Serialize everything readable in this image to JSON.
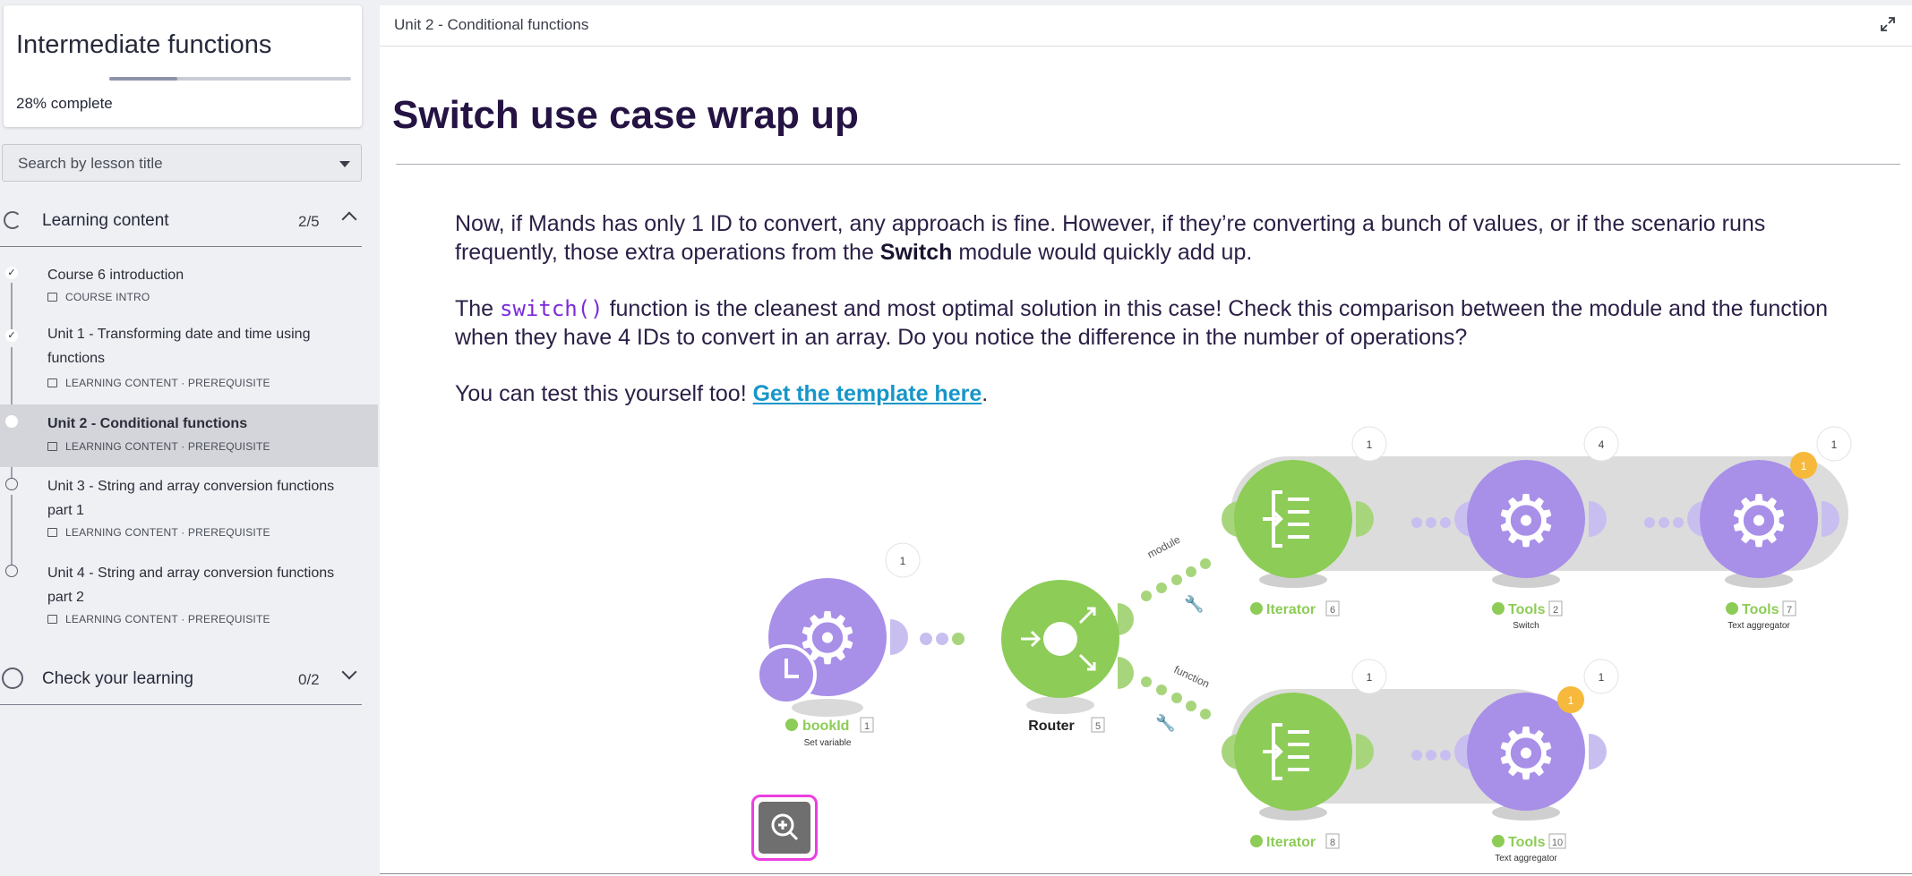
{
  "sidebar": {
    "course_title": "Intermediate functions",
    "progress_percent": 28,
    "progress_value": "28%",
    "progress_label": "complete",
    "search_placeholder": "Search by lesson title",
    "sections": [
      {
        "title": "Learning content",
        "count": "2/5",
        "expanded": true
      },
      {
        "title": "Check your learning",
        "count": "0/2",
        "expanded": false
      }
    ],
    "lessons": [
      {
        "title": "Course 6 introduction",
        "meta": "COURSE INTRO",
        "status": "done"
      },
      {
        "title": "Unit 1 - Transforming date and time using functions",
        "meta": "LEARNING CONTENT · PREREQUISITE",
        "status": "done"
      },
      {
        "title": "Unit 2 - Conditional functions",
        "meta": "LEARNING CONTENT · PREREQUISITE",
        "status": "current"
      },
      {
        "title": "Unit 3 - String and array conversion functions part 1",
        "meta": "LEARNING CONTENT · PREREQUISITE",
        "status": "todo"
      },
      {
        "title": "Unit 4 - String and array conversion functions part 2",
        "meta": "LEARNING CONTENT · PREREQUISITE",
        "status": "todo"
      }
    ]
  },
  "main": {
    "breadcrumb": "Unit 2 - Conditional functions",
    "heading": "Switch use case wrap up",
    "p1_a": "Now, if Mands has only 1 ID to convert, any approach is fine. However, if they’re converting a bunch of values, or if the scenario runs frequently, those extra operations from the ",
    "p1_bold": "Switch",
    "p1_b": " module would quickly add up.",
    "p2_a": "The ",
    "p2_code": "switch()",
    "p2_b": " function is the cleanest and most optimal solution in this case! Check this comparison between the module and the function when they have 4 IDs to convert in an array. Do you notice the difference in the number of operations?",
    "p3_a": "You can test this yourself too! ",
    "p3_link": "Get the template here",
    "p3_b": "."
  },
  "diagram": {
    "colors": {
      "purple": "#a88fe8",
      "green": "#8dcc57",
      "orange": "#f6b93b",
      "track": "#dcdcdc",
      "wrench": "#2f8fd8"
    },
    "route_labels": [
      "module",
      "function"
    ],
    "nodes": [
      {
        "name": "bookId",
        "num": "1",
        "sub": "Set variable",
        "bubble": "1",
        "kind": "tools-clock"
      },
      {
        "name": "Router",
        "num": "5",
        "sub": "",
        "bubble": "",
        "kind": "router"
      },
      {
        "name": "Iterator",
        "num": "6",
        "sub": "",
        "bubble": "1",
        "kind": "iterator"
      },
      {
        "name": "Tools",
        "num": "2",
        "sub": "Switch",
        "bubble": "4",
        "kind": "tools"
      },
      {
        "name": "Tools",
        "num": "7",
        "sub": "Text aggregator",
        "bubble": "1",
        "kind": "tools",
        "badge": "1"
      },
      {
        "name": "Iterator",
        "num": "8",
        "sub": "",
        "bubble": "1",
        "kind": "iterator"
      },
      {
        "name": "Tools",
        "num": "10",
        "sub": "Text aggregator",
        "bubble": "1",
        "kind": "tools",
        "badge": "1"
      }
    ]
  }
}
